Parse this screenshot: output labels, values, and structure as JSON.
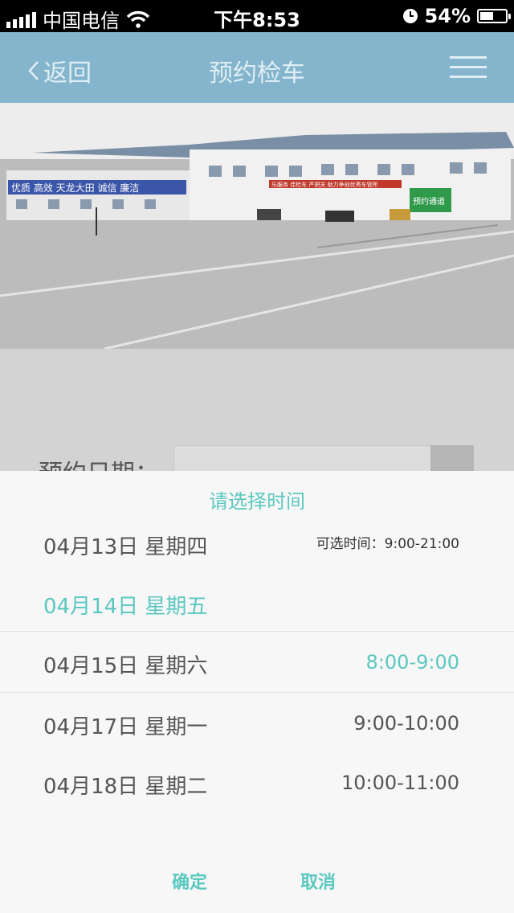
{
  "status_bar": {
    "carrier": "中国电信",
    "time": "下午8:53",
    "battery": "54%",
    "battery_level": 0.54
  },
  "nav": {
    "back_label": "返回",
    "title": "预约检车"
  },
  "photo": {
    "sign_left": "优质  高效  天龙大田  诚信  廉洁",
    "sign_red": "乐服务  佳检车  严把关  助力争创优秀车管所",
    "sign_green": "预约通道"
  },
  "form": {
    "date_label": "预约日期："
  },
  "picker": {
    "title": "请选择时间",
    "available_label": "可选时间：9:00-21:00",
    "dates": [
      "04月13日 星期四",
      "04月14日 星期五",
      "04月15日 星期六",
      "04月17日 星期一",
      "04月18日 星期二"
    ],
    "times": [
      "",
      "",
      "8:00-9:00",
      "9:00-10:00",
      "10:00-11:00"
    ],
    "selected_date": "04月14日 星期五",
    "selected_time": "8:00-9:00",
    "confirm": "确定",
    "cancel": "取消"
  },
  "colors": {
    "accent": "#5bc8c0",
    "nav_bg": "#85b5cd"
  }
}
